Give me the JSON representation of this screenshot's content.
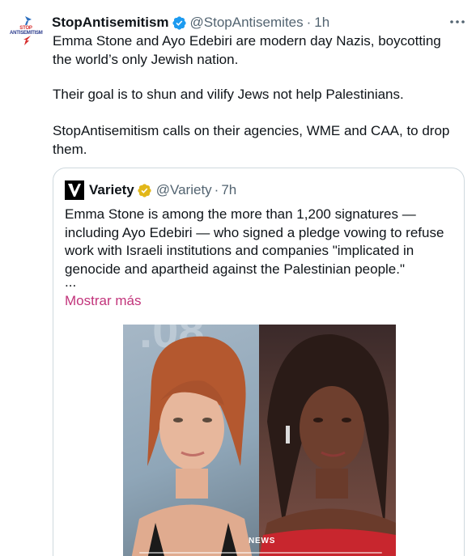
{
  "tweet": {
    "author": {
      "display_name": "StopAntisemitism",
      "handle": "@StopAntisemites",
      "verified_icon": "verified-badge-icon",
      "avatar_logo_text": [
        "STOP",
        "ANTISEMITISM"
      ]
    },
    "separator": "·",
    "time": "1h",
    "more_icon": "more-horizontal-icon",
    "paragraphs": [
      "Emma Stone and Ayo Edebiri are modern day Nazis, boycotting the world’s only Jewish nation.",
      "Their goal is to shun and vilify Jews not help Palestinians.",
      "StopAntisemitism calls on their agencies, WME and CAA, to drop them."
    ]
  },
  "quote": {
    "author": {
      "display_name": "Variety",
      "handle": "@Variety",
      "badge_icon": "gold-verified-badge-icon",
      "logo_icon": "variety-logo-icon"
    },
    "separator": "·",
    "time": "7h",
    "text": "Emma Stone is among the more than 1,200 signatures — including Ayo Edebiri — who signed a pledge vowing to refuse work with Israeli institutions and companies \"implicated in genocide and apartheid against the Palestinian people.\"",
    "ellipsis": "...",
    "show_more": "Mostrar más",
    "media": {
      "label": "NEWS",
      "video_progress": 0
    }
  },
  "colors": {
    "text": "#0f1419",
    "secondary": "#536471",
    "verified_blue": "#1d9bf0",
    "gold": "#e2b719",
    "link_pink": "#c2347b",
    "border": "#cfd9de"
  }
}
